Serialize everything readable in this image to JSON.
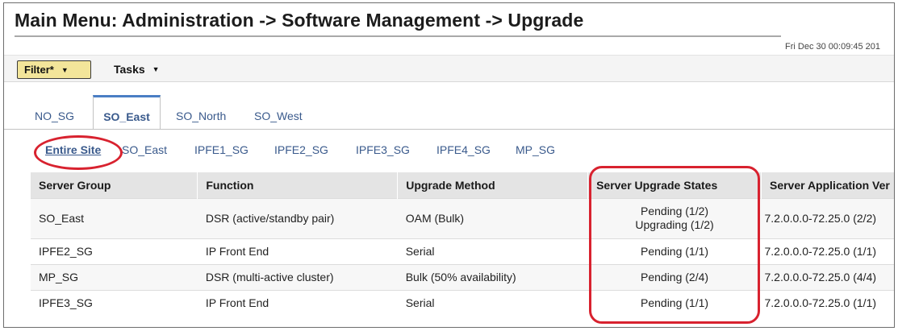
{
  "header": {
    "title": "Main Menu: Administration -> Software Management -> Upgrade",
    "timestamp": "Fri Dec 30 00:09:45 201"
  },
  "toolbar": {
    "filter_label": "Filter*",
    "tasks_label": "Tasks"
  },
  "tabs": [
    {
      "label": "NO_SG",
      "active": false
    },
    {
      "label": "SO_East",
      "active": true
    },
    {
      "label": "SO_North",
      "active": false
    },
    {
      "label": "SO_West",
      "active": false
    }
  ],
  "subtabs": [
    {
      "label": "Entire Site",
      "active": true
    },
    {
      "label": "SO_East",
      "active": false
    },
    {
      "label": "IPFE1_SG",
      "active": false
    },
    {
      "label": "IPFE2_SG",
      "active": false
    },
    {
      "label": "IPFE3_SG",
      "active": false
    },
    {
      "label": "IPFE4_SG",
      "active": false
    },
    {
      "label": "MP_SG",
      "active": false
    }
  ],
  "table": {
    "columns": [
      "Server Group",
      "Function",
      "Upgrade Method",
      "Server Upgrade States",
      "Server Application Ver"
    ],
    "rows": [
      {
        "group": "SO_East",
        "function": "DSR (active/standby pair)",
        "method": "OAM (Bulk)",
        "states": [
          "Pending (1/2)",
          "Upgrading (1/2)"
        ],
        "version": "7.2.0.0.0-72.25.0 (2/2)"
      },
      {
        "group": "IPFE2_SG",
        "function": "IP Front End",
        "method": "Serial",
        "states": [
          "Pending (1/1)"
        ],
        "version": "7.2.0.0.0-72.25.0 (1/1)"
      },
      {
        "group": "MP_SG",
        "function": "DSR (multi-active cluster)",
        "method": "Bulk (50% availability)",
        "states": [
          "Pending (2/4)"
        ],
        "version": "7.2.0.0.0-72.25.0 (4/4)"
      },
      {
        "group": "IPFE3_SG",
        "function": "IP Front End",
        "method": "Serial",
        "states": [
          "Pending (1/1)"
        ],
        "version": "7.2.0.0.0-72.25.0 (1/1)"
      }
    ]
  },
  "colors": {
    "annotation": "#d8222f",
    "link": "#3a5a8c",
    "filter_bg": "#f3e59a",
    "header_bg": "#e4e4e4"
  }
}
